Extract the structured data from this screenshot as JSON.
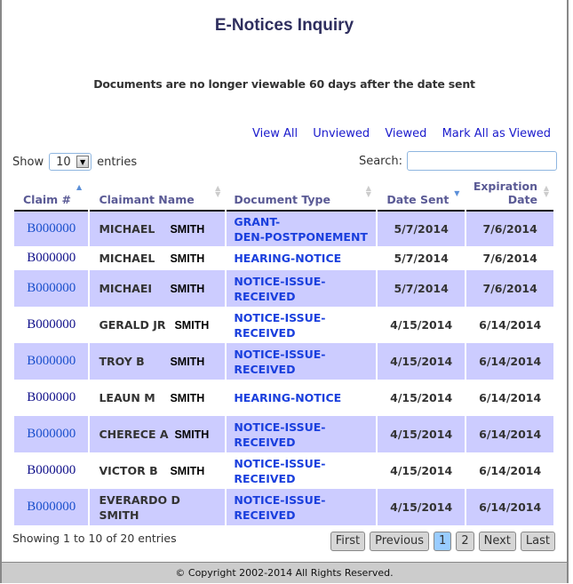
{
  "page": {
    "title": "E-Notices Inquiry",
    "notice": "Documents are no longer viewable 60 days after the date sent"
  },
  "filters": {
    "view_all": "View All",
    "unviewed": "Unviewed",
    "viewed": "Viewed",
    "mark_all": "Mark All as Viewed"
  },
  "length": {
    "show_label": "Show",
    "value": "10",
    "entries_label": "entries"
  },
  "search": {
    "label": "Search:",
    "value": ""
  },
  "table": {
    "columns": [
      "Claim #",
      "Claimant Name",
      "Document Type",
      "Date Sent",
      "Expiration Date"
    ],
    "expiration_line1": "Expiration",
    "expiration_line2": "Date",
    "rows": [
      {
        "claim": "B000000",
        "first": "MICHAEL",
        "last": "SMITH",
        "doc1": "GRANT-",
        "doc2": "DEN-POSTPONEMENT",
        "sent": "5/7/2014",
        "exp": "7/6/2014"
      },
      {
        "claim": "B000000",
        "first": "MICHAEL",
        "last": "SMITH",
        "doc1": "HEARING-NOTICE",
        "doc2": "",
        "sent": "5/7/2014",
        "exp": "7/6/2014"
      },
      {
        "claim": "B000000",
        "first": "MICHAEI",
        "last": "SMITH",
        "doc1": "NOTICE-ISSUE-",
        "doc2": "RECEIVED",
        "sent": "5/7/2014",
        "exp": "7/6/2014"
      },
      {
        "claim": "B000000",
        "first": "GERALD JR",
        "last": "SMITH",
        "doc1": "NOTICE-ISSUE-",
        "doc2": "RECEIVED",
        "sent": "4/15/2014",
        "exp": "6/14/2014"
      },
      {
        "claim": "B000000",
        "first": "TROY B",
        "last": "SMITH",
        "doc1": "NOTICE-ISSUE-",
        "doc2": "RECEIVED",
        "sent": "4/15/2014",
        "exp": "6/14/2014"
      },
      {
        "claim": "B000000",
        "first": "LEAUN M",
        "last": "SMITH",
        "doc1": "HEARING-NOTICE",
        "doc2": "",
        "sent": "4/15/2014",
        "exp": "6/14/2014"
      },
      {
        "claim": "B000000",
        "first": "CHERECE A",
        "last": "SMITH",
        "doc1": "NOTICE-ISSUE-",
        "doc2": "RECEIVED",
        "sent": "4/15/2014",
        "exp": "6/14/2014"
      },
      {
        "claim": "B000000",
        "first": "VICTOR B",
        "last": "SMITH",
        "doc1": "NOTICE-ISSUE-",
        "doc2": "RECEIVED",
        "sent": "4/15/2014",
        "exp": "6/14/2014"
      },
      {
        "claim": "B000000",
        "first": "EVERARDO D",
        "last": "SMITH",
        "doc1": "NOTICE-ISSUE-",
        "doc2": "RECEIVED",
        "sent": "4/15/2014",
        "exp": "6/14/2014"
      }
    ]
  },
  "info": "Showing 1 to 10 of 20 entries",
  "pager": {
    "first": "First",
    "previous": "Previous",
    "page1": "1",
    "page2": "2",
    "next": "Next",
    "last": "Last",
    "current": 1
  },
  "footer": "© Copyright 2002-2014 All Rights Reserved.",
  "colors": {
    "row_highlight": "#ccccff",
    "link": "#1a1acc",
    "title": "#2e2e5e",
    "current_page": "#99ccff"
  }
}
